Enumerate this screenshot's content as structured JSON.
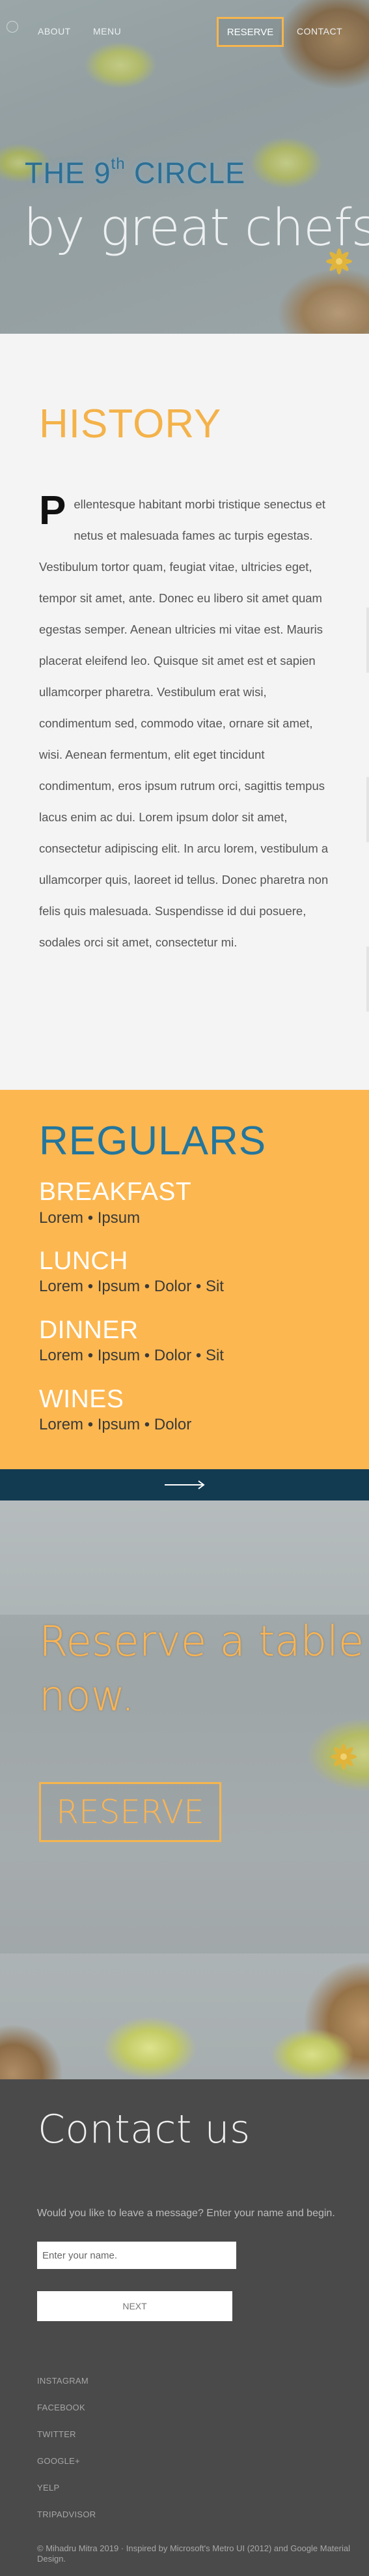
{
  "nav": {
    "about": "ABOUT",
    "menu": "MENU",
    "reserve": "RESERVE",
    "contact": "CONTACT"
  },
  "hero": {
    "title_prefix": "THE 9",
    "title_sup": "th",
    "title_suffix": " CIRCLE",
    "subtitle": "by great chefs"
  },
  "history": {
    "heading": "HISTORY",
    "dropcap": "P",
    "body": "ellentesque habitant morbi tristique senectus et netus et malesuada fames ac turpis egestas. Vestibulum tortor quam, feugiat vitae, ultricies eget, tempor sit amet, ante. Donec eu libero sit amet quam egestas semper. Aenean ultricies mi vitae est. Mauris placerat eleifend leo. Quisque sit amet est et sapien ullamcorper pharetra. Vestibulum erat wisi, condimentum sed, commodo vitae, ornare sit amet, wisi. Aenean fermentum, elit eget tincidunt condimentum, eros ipsum rutrum orci, sagittis tempus lacus enim ac dui. Lorem ipsum dolor sit amet, consectetur adipiscing elit. In arcu lorem, vestibulum a ullamcorper quis, laoreet id tellus. Donec pharetra non felis quis malesuada. Suspendisse id dui posuere, sodales orci sit amet, consectetur mi."
  },
  "regulars": {
    "heading": "REGULARS",
    "categories": [
      {
        "name": "BREAKFAST",
        "items": "Lorem • Ipsum"
      },
      {
        "name": "LUNCH",
        "items": "Lorem • Ipsum • Dolor • Sit"
      },
      {
        "name": "DINNER",
        "items": "Lorem • Ipsum • Dolor • Sit"
      },
      {
        "name": "WINES",
        "items": "Lorem • Ipsum • Dolor"
      }
    ]
  },
  "reserve": {
    "title_line1": "Reserve a table",
    "title_line2": "now.",
    "button": "RESERVE"
  },
  "contact": {
    "heading": "Contact us",
    "prompt": "Would you like to leave a message? Enter your name and begin.",
    "name_placeholder": "Enter your name.",
    "next": "NEXT",
    "social": [
      "INSTAGRAM",
      "FACEBOOK",
      "TWITTER",
      "GOOGLE+",
      "YELP",
      "TRIPADVISOR"
    ],
    "footer": "© Mihadru Mitra 2019 · Inspired by Microsoft's Metro UI (2012) and Google Material Design."
  },
  "colors": {
    "accent_orange": "#fdb750",
    "accent_blue": "#23769d",
    "dark_bar": "#123b52",
    "contact_bg": "#4a4a4a"
  },
  "icons": [
    "logo-icon",
    "arrow-right-icon",
    "star-anise-icon"
  ]
}
